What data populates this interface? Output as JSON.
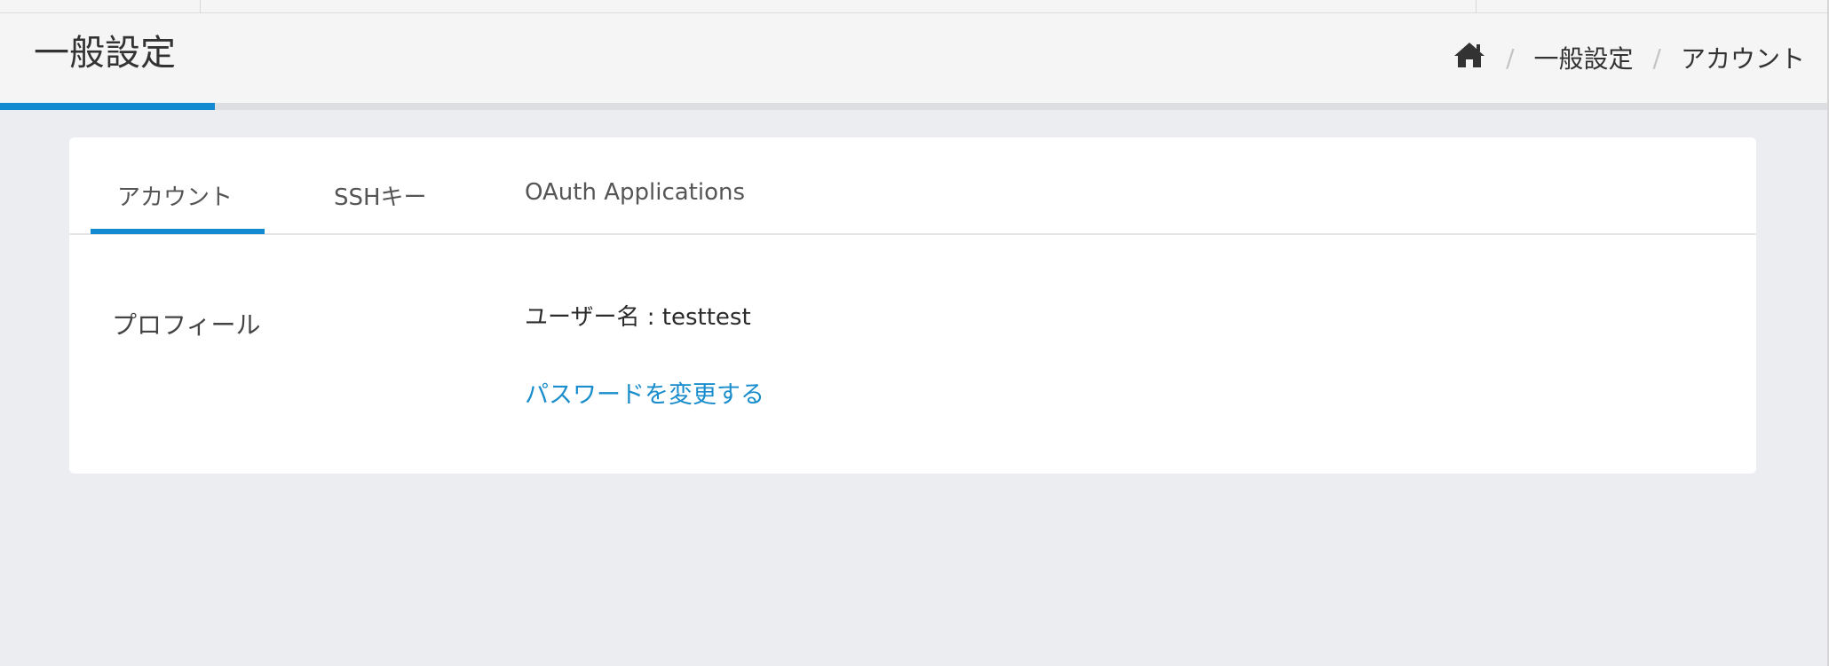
{
  "header": {
    "title": "一般設定"
  },
  "breadcrumb": {
    "home_icon": "home-icon",
    "separator": "/",
    "items": [
      "一般設定",
      "アカウント"
    ]
  },
  "tabs": [
    {
      "label": "アカウント",
      "active": true
    },
    {
      "label": "SSHキー",
      "active": false
    },
    {
      "label": "OAuth Applications",
      "active": false
    }
  ],
  "profile": {
    "section_label": "プロフィール",
    "username_label": "ユーザー名 : ",
    "username": "testtest",
    "change_password_link": "パスワードを変更する"
  },
  "colors": {
    "accent": "#1289d0",
    "link": "#1a8dcc",
    "background": "#ebedf0",
    "header_bg": "#f5f5f5"
  }
}
